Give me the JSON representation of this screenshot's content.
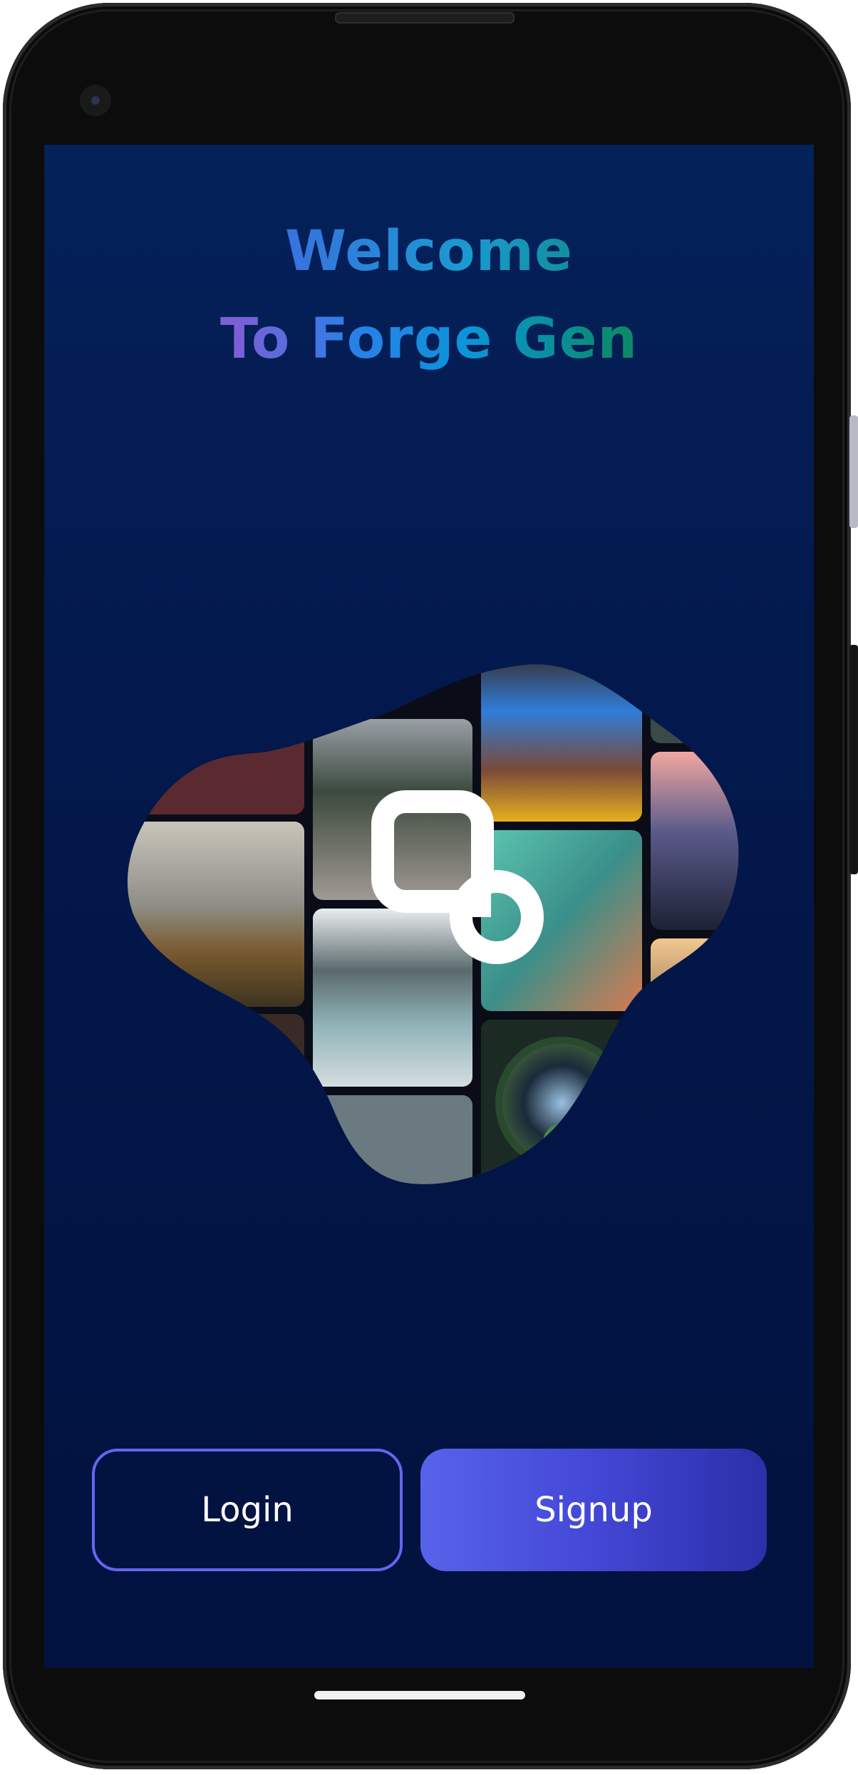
{
  "screen": {
    "title_line1": "Welcome",
    "title_line2": "To Forge Gen",
    "hero_logo_icon": "forge-gen-logo-icon"
  },
  "actions": {
    "login_label": "Login",
    "signup_label": "Signup"
  },
  "colors": {
    "background_top": "#04215a",
    "background_bottom": "#02123f",
    "accent": "#6366f1",
    "signup_gradient_start": "#5763ea",
    "signup_gradient_end": "#2b2fa8"
  }
}
